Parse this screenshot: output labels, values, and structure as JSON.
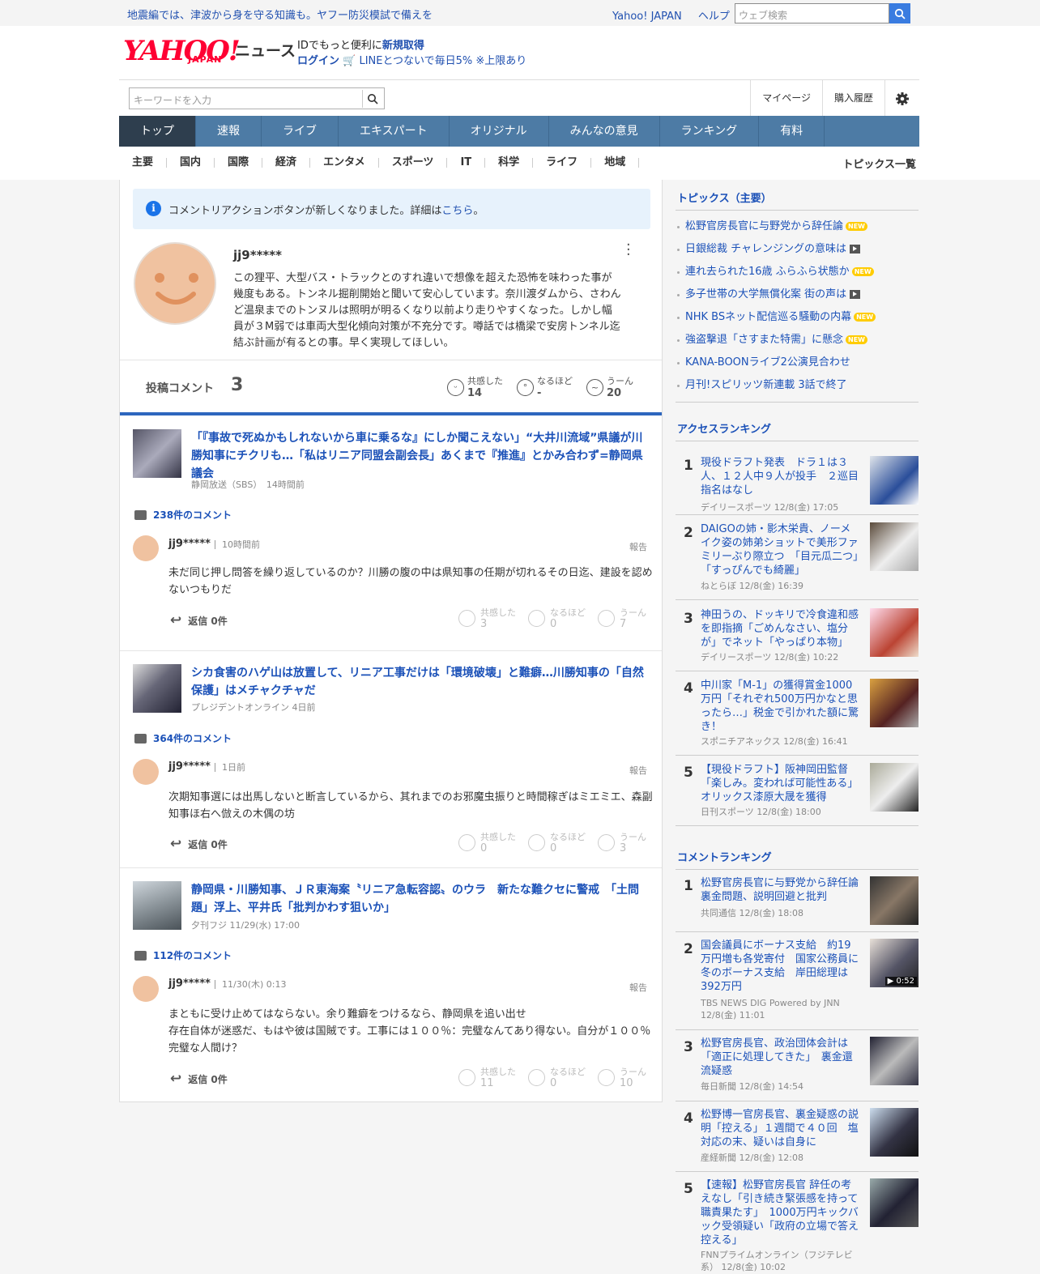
{
  "topbar": {
    "notice": "地震編では、津波から身を守る知識も。ヤフー防災模試で備えを",
    "link1": "Yahoo! JAPAN",
    "link2": "ヘルプ",
    "search_placeholder": "ウェブ検索"
  },
  "header": {
    "logo": "YAHOO!",
    "logo_sub": "JAPAN",
    "news": "ニュース",
    "id_line1": "IDでもっと便利に",
    "id_register": "新規取得",
    "login": "ログイン",
    "line_promo": "LINEとつないで毎日5% ※上限あり"
  },
  "search": {
    "placeholder": "キーワードを入力",
    "mypage": "マイページ",
    "history": "購入履歴"
  },
  "gnav": [
    "トップ",
    "速報",
    "ライブ",
    "エキスパート",
    "オリジナル",
    "みんなの意見",
    "ランキング",
    "有料"
  ],
  "subnav": [
    "主要",
    "国内",
    "国際",
    "経済",
    "エンタメ",
    "スポーツ",
    "IT",
    "科学",
    "ライフ",
    "地域"
  ],
  "subnav_all": "トピックス一覧",
  "notice": {
    "text": "コメントリアクションボタンが新しくなりました。詳細は",
    "link": "こちら",
    "end": "。"
  },
  "profile": {
    "name": "jj9*****",
    "text": "この狸平、大型バス・トラックとのすれ違いで想像を超えた恐怖を味わった事が幾度もある。トンネル掘削開始と聞いて安心しています。奈川渡ダムから、さわんど温泉までのトンヌルは照明が明るくなり以前より走りやすくなった。しかし幅員が３M弱では車両大型化傾向対策が不充分です。噂話では橋梁で安房トンネル迄結ぶ計画が有るとの事。早く実現してほしい。",
    "posts_label": "投稿コメント",
    "posts_count": "3",
    "reactions": [
      {
        "label": "共感した",
        "value": "14"
      },
      {
        "label": "なるほど",
        "value": "-"
      },
      {
        "label": "うーん",
        "value": "20"
      }
    ]
  },
  "threads": [
    {
      "title": "「『事故で死ぬかもしれないから車に乗るな』にしか聞こえない」“大井川流域”県議が川勝知事にチクリも…「私はリニア同盟会副会長」あくまで『推進』とかみ合わず=静岡県議会",
      "source": "静岡放送（SBS）　14時間前",
      "count": "238件のコメント",
      "user": "jj9*****",
      "time": "10時間前",
      "report": "報告",
      "text": "未だ同じ押し問答を繰り返しているのか？川勝の腹の中は県知事の任期が切れるその日迄、建設を認めないつもりだ",
      "reply": "返信 0件",
      "r": [
        {
          "label": "共感した",
          "value": "3"
        },
        {
          "label": "なるほど",
          "value": "0"
        },
        {
          "label": "うーん",
          "value": "7"
        }
      ]
    },
    {
      "title": "シカ食害のハゲ山は放置して、リニア工事だけは「環境破壊」と難癖…川勝知事の「自然保護」はメチャクチャだ",
      "source": "プレジデントオンライン 4日前",
      "count": "364件のコメント",
      "user": "jj9*****",
      "time": "1日前",
      "report": "報告",
      "text": "次期知事選には出馬しないと断言しているから、其れまでのお邪魔虫振りと時間稼ぎはミエミエ、森副知事ほ右へ倣えの木偶の坊",
      "reply": "返信 0件",
      "r": [
        {
          "label": "共感した",
          "value": "0"
        },
        {
          "label": "なるほど",
          "value": "0"
        },
        {
          "label": "うーん",
          "value": "3"
        }
      ]
    },
    {
      "title": "静岡県・川勝知事、ＪＲ東海案〝リニア急転容認〟のウラ　新たな難クセに警戒　「土問題」浮上、平井氏「批判かわす狙いか」",
      "source": "夕刊フジ 11/29(水) 17:00",
      "count": "112件のコメント",
      "user": "jj9*****",
      "time": "11/30(木) 0:13",
      "report": "報告",
      "text": "まともに受け止めてはならない。余り難癖をつけるなら、静岡県を追い出せ\n存在自体が迷惑だ、もはや彼は国賊です。工事には１００％：完璧なんてあり得ない。自分が１００％完璧な人間け？",
      "reply": "返信 0件",
      "r": [
        {
          "label": "共感した",
          "value": "11"
        },
        {
          "label": "なるほど",
          "value": "0"
        },
        {
          "label": "うーん",
          "value": "10"
        }
      ]
    }
  ],
  "sidebar": {
    "topics_title": "トピックス（主要）",
    "topics": [
      {
        "t": "松野官房長官に与野党から辞任論",
        "b": "new"
      },
      {
        "t": "日銀総裁 チャレンジングの意味は",
        "b": "video"
      },
      {
        "t": "連れ去られた16歳 ふらふら状態か",
        "b": "new"
      },
      {
        "t": "多子世帯の大学無償化案 街の声は",
        "b": "video"
      },
      {
        "t": "NHK BSネット配信巡る騒動の内幕",
        "b": "new"
      },
      {
        "t": "強盗撃退「さすまた特需」に懸念",
        "b": "new"
      },
      {
        "t": "KANA-BOONライブ2公演見合わせ",
        "b": ""
      },
      {
        "t": "月刊!スピリッツ新連載 3話で終了",
        "b": ""
      }
    ],
    "new_label": "NEW",
    "access_title": "アクセスランキング",
    "access": [
      {
        "n": "1",
        "t": "現役ドラフト発表　ドラ１は３人、１２人中９人が投手　２巡目指名はなし",
        "s": "デイリースポーツ 12/8(金) 17:05"
      },
      {
        "n": "2",
        "t": "DAIGOの姉・影木栄貴、ノーメイク姿の姉弟ショットで美形ファミリーぶり際立つ　「目元瓜二つ」「すっぴんでも綺麗」",
        "s": "ねとらぼ 12/8(金) 16:39"
      },
      {
        "n": "3",
        "t": "神田うの、ドッキリで冷食違和感を即指摘「ごめんなさい、塩分が」でネット「やっぱり本物」",
        "s": "デイリースポーツ 12/8(金) 10:22"
      },
      {
        "n": "4",
        "t": "中川家「M-1」の獲得賞金1000万円「それぞれ500万円かなと思ったら…」税金で引かれた額に驚き！",
        "s": "スポニチアネックス 12/8(金) 16:41"
      },
      {
        "n": "5",
        "t": "【現役ドラフト】阪神岡田監督「楽しみ。変われば可能性ある」オリックス漆原大晟を獲得",
        "s": "日刊スポーツ 12/8(金) 18:00"
      }
    ],
    "comment_title": "コメントランキング",
    "comments": [
      {
        "n": "1",
        "t": "松野官房長官に与野党から辞任論　裏金問題、説明回避と批判",
        "s": "共同通信 12/8(金) 18:08"
      },
      {
        "n": "2",
        "t": "国会議員にボーナス支給　約19万円増も各党寄付　国家公務員に冬のボーナス支給　岸田総理は392万円",
        "s": "TBS NEWS DIG Powered by JNN 12/8(金) 11:01",
        "dur": "0:52"
      },
      {
        "n": "3",
        "t": "松野官房長官、政治団体会計は「適正に処理してきた」　裏金還流疑惑",
        "s": "毎日新聞 12/8(金) 14:54"
      },
      {
        "n": "4",
        "t": "松野博一官房長官、裏金疑惑の説明「控える」１週間で４０回　塩対応の末、疑いは自身に",
        "s": "産経新聞 12/8(金) 12:08"
      },
      {
        "n": "5",
        "t": "【速報】松野官房長官 辞任の考えなし「引き続き緊張感を持って職責果たす」　1000万円キックバック受領疑い「政府の立場で答え控える」",
        "s": "FNNプライムオンライン（フジテレビ系） 12/8(金) 10:02"
      }
    ]
  }
}
